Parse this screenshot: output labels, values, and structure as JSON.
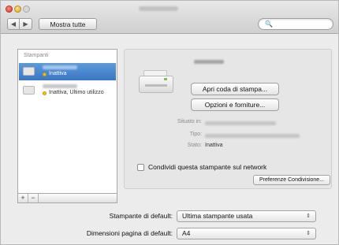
{
  "toolbar": {
    "back_icon": "◀",
    "forward_icon": "▶",
    "show_all_label": "Mostra tutte",
    "search_placeholder": "",
    "search_icon": "🔍"
  },
  "printers": {
    "header": "Stampanti",
    "items": [
      {
        "status": "Inattiva",
        "selected": true
      },
      {
        "status": "Inattiva, Ultimo utilizzo",
        "selected": false
      }
    ],
    "add_label": "+",
    "remove_label": "−"
  },
  "detail": {
    "open_queue_label": "Apri coda di stampa...",
    "options_label": "Opzioni e forniture...",
    "location_label": "Situato in:",
    "type_label": "Tipo:",
    "state_label": "Stato:",
    "state_value": "Inattiva",
    "share_label": "Condividi questa stampante sul network",
    "sharing_prefs_label": "Preferenze Condivisione..."
  },
  "defaults": {
    "printer_label": "Stampante di default:",
    "printer_value": "Ultima stampante usata",
    "paper_label": "Dimensioni pagina di default:",
    "paper_value": "A4",
    "popup_arrows": "⇕"
  },
  "colors": {
    "selection": "#3a76c4",
    "status_idle": "#f0c419"
  }
}
